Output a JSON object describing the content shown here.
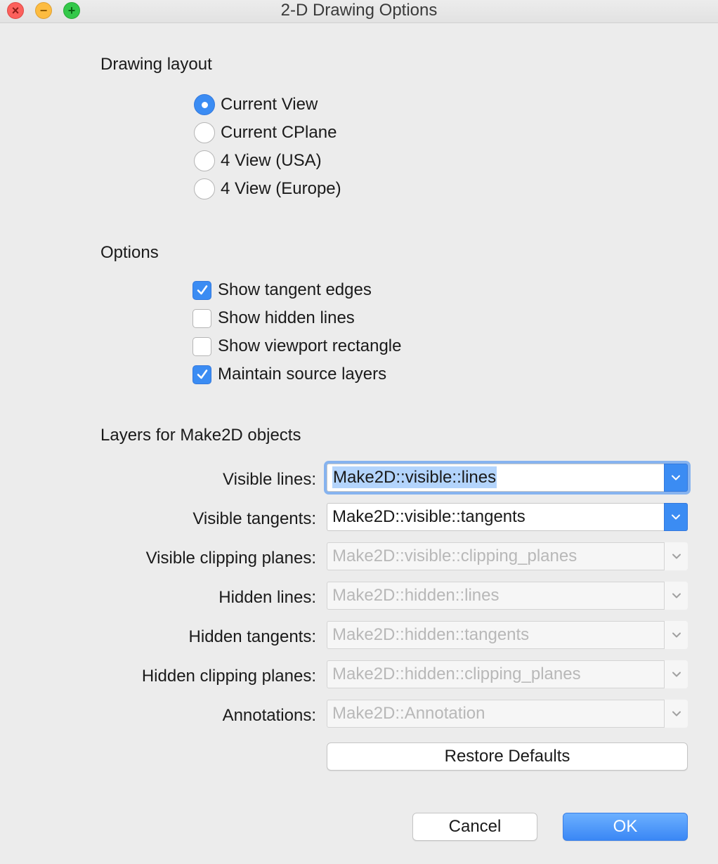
{
  "window": {
    "title": "2-D Drawing Options"
  },
  "layout_section": {
    "heading": "Drawing layout",
    "options": [
      {
        "label": "Current View",
        "selected": true
      },
      {
        "label": "Current CPlane",
        "selected": false
      },
      {
        "label": "4 View (USA)",
        "selected": false
      },
      {
        "label": "4 View (Europe)",
        "selected": false
      }
    ]
  },
  "options_section": {
    "heading": "Options",
    "checkboxes": [
      {
        "label": "Show tangent edges",
        "checked": true
      },
      {
        "label": "Show hidden lines",
        "checked": false
      },
      {
        "label": "Show viewport rectangle",
        "checked": false
      },
      {
        "label": "Maintain source layers",
        "checked": true
      }
    ]
  },
  "layers_section": {
    "heading": "Layers for Make2D objects",
    "fields": [
      {
        "label": "Visible lines:",
        "value": "Make2D::visible::lines",
        "enabled": true,
        "focused": true
      },
      {
        "label": "Visible tangents:",
        "value": "Make2D::visible::tangents",
        "enabled": true,
        "focused": false
      },
      {
        "label": "Visible clipping planes:",
        "value": "Make2D::visible::clipping_planes",
        "enabled": false,
        "focused": false
      },
      {
        "label": "Hidden lines:",
        "value": "Make2D::hidden::lines",
        "enabled": false,
        "focused": false
      },
      {
        "label": "Hidden tangents:",
        "value": "Make2D::hidden::tangents",
        "enabled": false,
        "focused": false
      },
      {
        "label": "Hidden clipping planes:",
        "value": "Make2D::hidden::clipping_planes",
        "enabled": false,
        "focused": false
      },
      {
        "label": "Annotations:",
        "value": "Make2D::Annotation",
        "enabled": false,
        "focused": false
      }
    ],
    "restore_label": "Restore Defaults"
  },
  "footer": {
    "cancel_label": "Cancel",
    "ok_label": "OK"
  },
  "colors": {
    "accent": "#3b8cf3",
    "background": "#ececec",
    "disabled_text": "#b8b8b8"
  }
}
